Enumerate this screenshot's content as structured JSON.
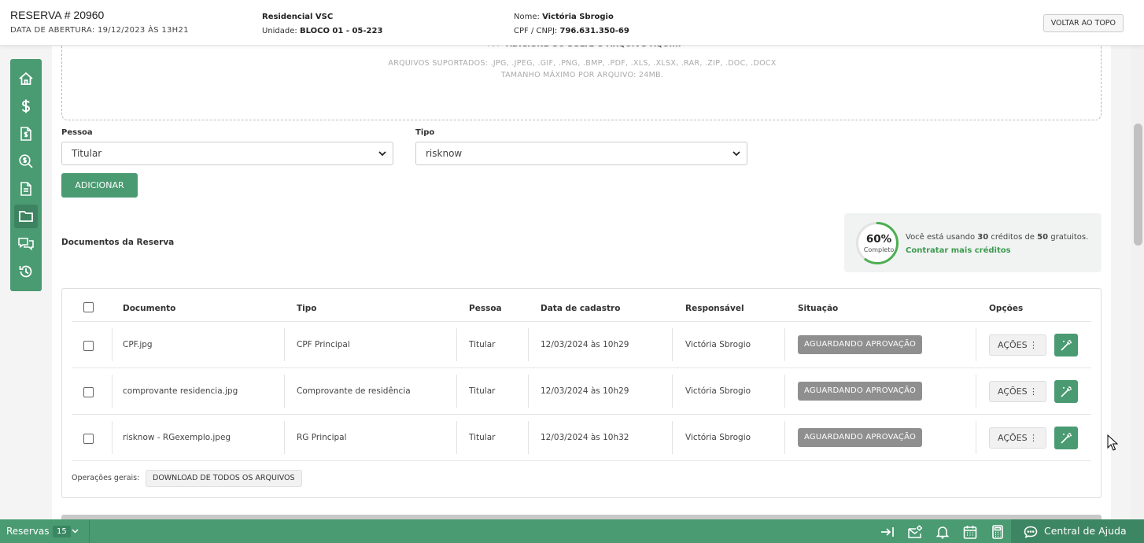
{
  "header": {
    "title": "RESERVA # 20960",
    "opened": "DATA DE ABERTURA: 19/12/2023 ÀS 13H21",
    "residential": "Residencial VSC",
    "unit_label": "Unidade:",
    "unit_value": "BLOCO 01 - 05-223",
    "name_label": "Nome:",
    "name_value": "Victória Sbrogio",
    "cpf_label": "CPF / CNPJ:",
    "cpf_value": "796.631.350-69",
    "top_button": "VOLTAR AO TOPO"
  },
  "sidebar": {
    "items": [
      {
        "icon": "home-icon",
        "active": false
      },
      {
        "icon": "dollar-icon",
        "active": false
      },
      {
        "icon": "invoice-icon",
        "active": false
      },
      {
        "icon": "money-search-icon",
        "active": false
      },
      {
        "icon": "document-icon",
        "active": false
      },
      {
        "icon": "folder-icon",
        "active": true
      },
      {
        "icon": "chat-icon",
        "active": false
      },
      {
        "icon": "history-icon",
        "active": false
      }
    ]
  },
  "upload": {
    "heading": "ADICIONE OU SOLTE O ARQUIVO AQUI...",
    "supported": "ARQUIVOS SUPORTADOS: .JPG, .JPEG, .GIF, .PNG, .BMP, .PDF, .XLS, .XLSX, .RAR, .ZIP, .DOC, .DOCX",
    "max_size": "TAMANHO MÁXIMO POR ARQUIVO: 24MB."
  },
  "form": {
    "person_label": "Pessoa",
    "person_value": "Titular",
    "type_label": "Tipo",
    "type_value": "risknow",
    "add_button": "ADICIONAR"
  },
  "documents": {
    "section_title": "Documentos da Reserva",
    "columns": [
      "Documento",
      "Tipo",
      "Pessoa",
      "Data de cadastro",
      "Responsável",
      "Situação",
      "Opções"
    ],
    "rows": [
      {
        "document": "CPF.jpg",
        "type": "CPF Principal",
        "person": "Titular",
        "date": "12/03/2024 às 10h29",
        "responsible": "Victória Sbrogio",
        "status": "AGUARDANDO APROVAÇÃO",
        "actions": "AÇÕES"
      },
      {
        "document": "comprovante residencia.jpg",
        "type": "Comprovante de residência",
        "person": "Titular",
        "date": "12/03/2024 às 10h29",
        "responsible": "Victória Sbrogio",
        "status": "AGUARDANDO APROVAÇÃO",
        "actions": "AÇÕES"
      },
      {
        "document": "risknow - RGexemplo.jpeg",
        "type": "RG Principal",
        "person": "Titular",
        "date": "12/03/2024 às 10h32",
        "responsible": "Victória Sbrogio",
        "status": "AGUARDANDO APROVAÇÃO",
        "actions": "AÇÕES"
      }
    ],
    "general_ops_label": "Operações gerais:",
    "download_all": "DOWNLOAD DE TODOS OS ARQUIVOS"
  },
  "credits": {
    "percent": "60%",
    "percent_value": 0.6,
    "percent_sub": "Completo",
    "text_pre": "Você está usando ",
    "used": "30",
    "text_mid": " créditos de ",
    "total": "50",
    "text_post": " gratuitos.",
    "link": "Contratar mais créditos"
  },
  "bottom_bar": {
    "reservations_label": "Reservas",
    "reservations_count": "15",
    "icons": [
      "exit-icon",
      "mail-settings-icon",
      "bell-icon",
      "calendar-icon",
      "calculator-icon"
    ],
    "help_label": "Central de Ajuda"
  },
  "colors": {
    "brand": "#4a9a72",
    "brand_dark": "#3d8361",
    "status_badge": "#8f8f8f",
    "link_green": "#3d9a4f"
  }
}
